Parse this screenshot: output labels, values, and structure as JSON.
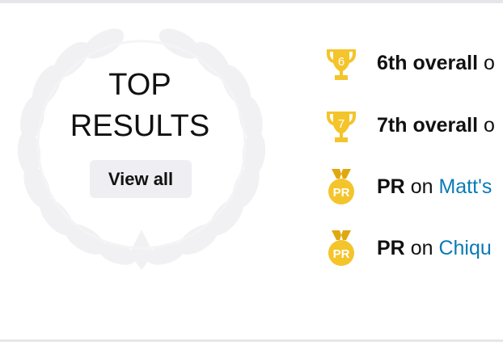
{
  "widget": {
    "title_line1": "TOP",
    "title_line2": "RESULTS",
    "view_all_label": "View all"
  },
  "results": [
    {
      "icon": "trophy-icon",
      "badge": "6",
      "bold": "6th overall",
      "rest": "o",
      "link": ""
    },
    {
      "icon": "trophy-icon",
      "badge": "7",
      "bold": "7th overall",
      "rest": "o",
      "link": ""
    },
    {
      "icon": "medal-icon",
      "badge": "PR",
      "bold": "PR",
      "rest": "on",
      "link": "Matt's"
    },
    {
      "icon": "medal-icon",
      "badge": "PR",
      "bold": "PR",
      "rest": "on",
      "link": "Chiqu"
    }
  ],
  "colors": {
    "gold": "#f4c42b",
    "gold_dark": "#e0a80f",
    "link": "#0a7bb5",
    "button_bg": "#efeff3",
    "wreath": "#f1f1f3"
  }
}
